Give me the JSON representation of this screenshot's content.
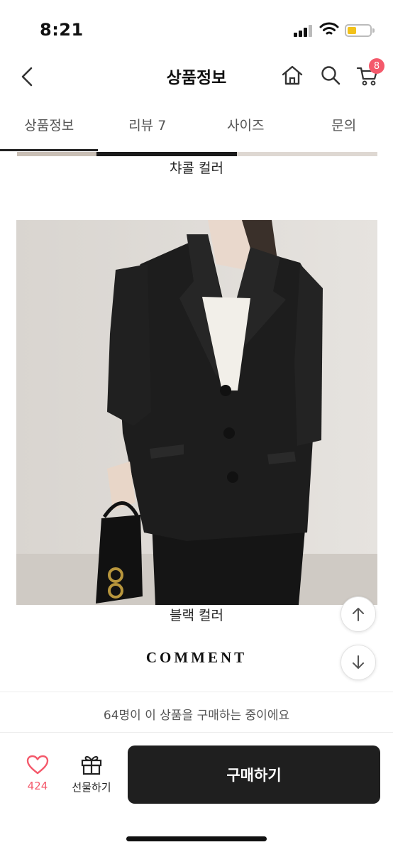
{
  "status_bar": {
    "time": "8:21"
  },
  "header": {
    "title": "상품정보",
    "cart_count": "8"
  },
  "tabs": [
    {
      "label": "상품정보"
    },
    {
      "label": "리뷰 7"
    },
    {
      "label": "사이즈"
    },
    {
      "label": "문의"
    }
  ],
  "content": {
    "caption_charcoal": "챠콜 컬러",
    "caption_black": "블랙 컬러",
    "comment_title": "COMMENT"
  },
  "viewers_text": "64명이 이 상품을 구매하는 중이에요",
  "bottom": {
    "like_count": "424",
    "gift_label": "선물하기",
    "buy_label": "구매하기"
  },
  "colors": {
    "accent": "#f4596b",
    "buy_button": "#1f1f1f",
    "battery": "#f2c21b"
  },
  "icons": [
    "back-arrow-icon",
    "home-icon",
    "search-icon",
    "cart-icon",
    "arrow-up-icon",
    "arrow-down-icon",
    "heart-icon",
    "gift-icon",
    "signal-icon",
    "wifi-icon",
    "battery-icon"
  ]
}
